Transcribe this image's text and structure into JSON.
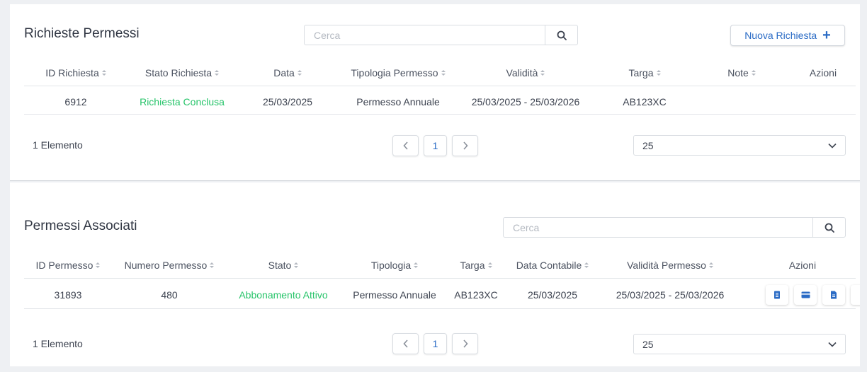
{
  "richieste": {
    "title": "Richieste Permessi",
    "search_placeholder": "Cerca",
    "new_button": "Nuova Richiesta",
    "columns": [
      "ID Richiesta",
      "Stato Richiesta",
      "Data",
      "Tipologia Permesso",
      "Validità",
      "Targa",
      "Note",
      "Azioni"
    ],
    "rows": [
      {
        "id": "6912",
        "stato": "Richiesta Conclusa",
        "data": "25/03/2025",
        "tipologia": "Permesso Annuale",
        "validita": "25/03/2025 - 25/03/2026",
        "targa": "AB123XC",
        "note": ""
      }
    ],
    "count": "1 Elemento",
    "page": "1",
    "page_size": "25"
  },
  "associati": {
    "title": "Permessi Associati",
    "search_placeholder": "Cerca",
    "columns": [
      "ID Permesso",
      "Numero Permesso",
      "Stato",
      "Tipologia",
      "Targa",
      "Data Contabile",
      "Validità Permesso",
      "Azioni"
    ],
    "rows": [
      {
        "id": "31893",
        "numero": "480",
        "stato": "Abbonamento Attivo",
        "tipologia": "Permesso Annuale",
        "targa": "AB123XC",
        "data_contabile": "25/03/2025",
        "validita": "25/03/2025 - 25/03/2026"
      }
    ],
    "count": "1 Elemento",
    "page": "1",
    "page_size": "25"
  },
  "icons": {
    "search": "search-icon",
    "plus": "plus-icon",
    "prev": "chevron-left-icon",
    "next": "chevron-right-icon",
    "dropdown": "chevron-down-icon",
    "actions": [
      "receipt-icon",
      "card-icon",
      "document-icon"
    ]
  },
  "colors": {
    "accent": "#2a6bc5",
    "status_green": "#27c46a"
  }
}
